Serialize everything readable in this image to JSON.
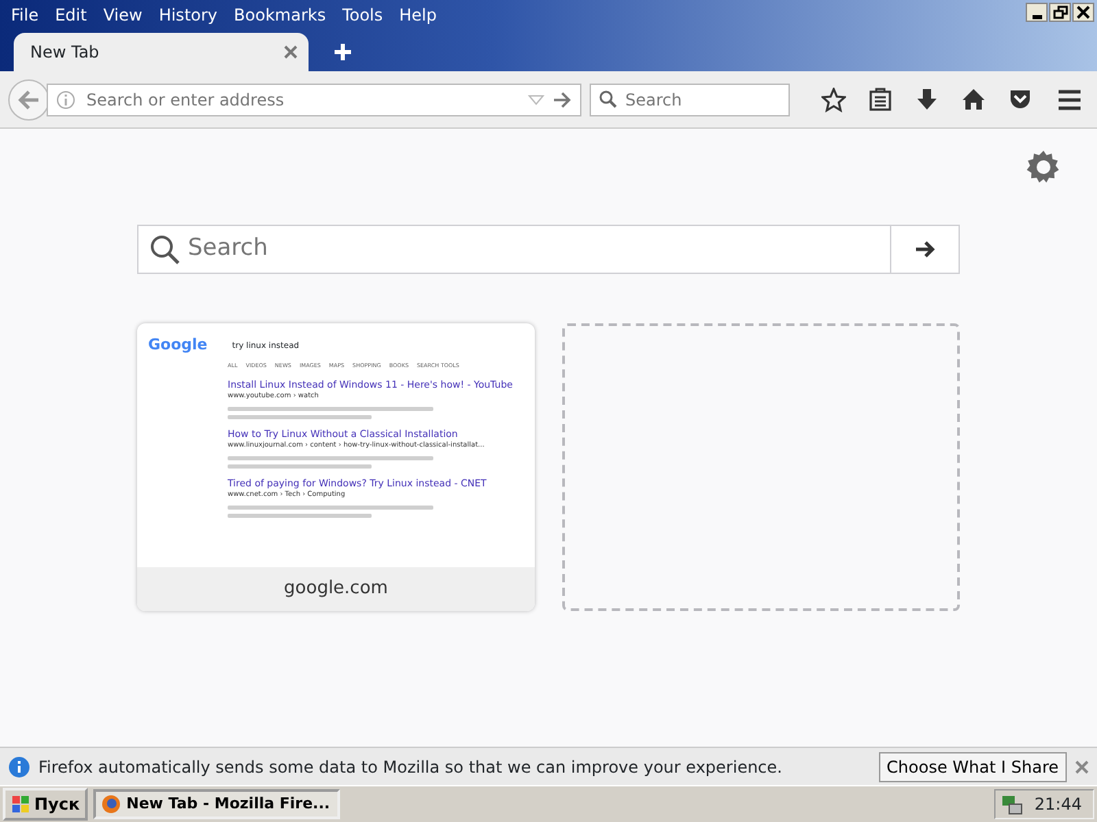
{
  "menu": [
    "File",
    "Edit",
    "View",
    "History",
    "Bookmarks",
    "Tools",
    "Help"
  ],
  "tabs": [
    {
      "label": "New Tab",
      "selected": true
    }
  ],
  "address_bar": {
    "placeholder": "Search or enter address"
  },
  "search_bar": {
    "placeholder": "Search"
  },
  "new_tab_page": {
    "search": {
      "placeholder": "Search"
    },
    "tiles": [
      {
        "kind": "thumbnail",
        "title": "google.com",
        "preview": {
          "logo": "Google",
          "query": "try linux instead",
          "tabs": [
            "ALL",
            "VIDEOS",
            "NEWS",
            "IMAGES",
            "MAPS",
            "SHOPPING",
            "BOOKS",
            "SEARCH TOOLS"
          ],
          "results": [
            {
              "title": "Install Linux Instead of Windows 11 - Here's how! - YouTube",
              "url": "www.youtube.com › watch"
            },
            {
              "title": "How to Try Linux Without a Classical Installation",
              "url": "www.linuxjournal.com › content › how-try-linux-without-classical-installat..."
            },
            {
              "title": "Tired of paying for Windows? Try Linux instead - CNET",
              "url": "www.cnet.com › Tech › Computing"
            }
          ]
        }
      },
      {
        "kind": "empty"
      }
    ]
  },
  "notification": {
    "message": "Firefox automatically sends some data to Mozilla so that we can improve your experience.",
    "button": "Choose What I Share"
  },
  "taskbar": {
    "start": "Пуск",
    "tasks": [
      {
        "label": "New Tab - Mozilla Fire...",
        "selected": true
      }
    ],
    "clock": "21:44"
  }
}
